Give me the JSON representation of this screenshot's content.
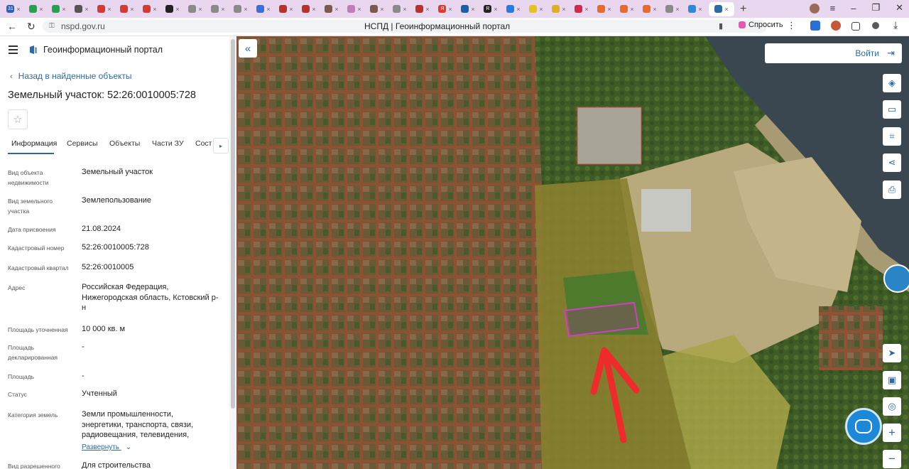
{
  "browser": {
    "tab_favicons": [
      {
        "icon": "calendar-favicon",
        "color": "#2b5fbd",
        "text": "31"
      },
      {
        "icon": "check-favicon",
        "color": "#23a34a",
        "text": ""
      },
      {
        "icon": "check-favicon",
        "color": "#23a34a",
        "text": ""
      },
      {
        "icon": "globe-favicon",
        "color": "#555555",
        "text": ""
      },
      {
        "icon": "record-favicon",
        "color": "#d63a2e",
        "text": ""
      },
      {
        "icon": "record-favicon",
        "color": "#d63a2e",
        "text": ""
      },
      {
        "icon": "record-favicon",
        "color": "#d63a2e",
        "text": ""
      },
      {
        "icon": "dark-favicon",
        "color": "#222222",
        "text": ""
      },
      {
        "icon": "grid-favicon",
        "color": "#8a8a8a",
        "text": ""
      },
      {
        "icon": "grid-favicon",
        "color": "#8a8a8a",
        "text": ""
      },
      {
        "icon": "grid-favicon",
        "color": "#8a8a8a",
        "text": ""
      },
      {
        "icon": "blue-favicon",
        "color": "#3b6fd8",
        "text": ""
      },
      {
        "icon": "emblem-favicon",
        "color": "#b8322a",
        "text": ""
      },
      {
        "icon": "emblem-favicon",
        "color": "#b8322a",
        "text": ""
      },
      {
        "icon": "photo-favicon",
        "color": "#7a5a4a",
        "text": ""
      },
      {
        "icon": "page-favicon",
        "color": "#c77ab8",
        "text": ""
      },
      {
        "icon": "photo-favicon",
        "color": "#7a5a4a",
        "text": ""
      },
      {
        "icon": "grid-favicon",
        "color": "#8a8a8a",
        "text": ""
      },
      {
        "icon": "emblem-favicon",
        "color": "#b8322a",
        "text": ""
      },
      {
        "icon": "yandex-favicon",
        "color": "#e23a2a",
        "text": "Я"
      },
      {
        "icon": "camera-favicon",
        "color": "#1a5fa8",
        "text": ""
      },
      {
        "icon": "r-favicon",
        "color": "#222222",
        "text": "R"
      },
      {
        "icon": "edit-favicon",
        "color": "#2a7be0",
        "text": ""
      },
      {
        "icon": "smile-favicon",
        "color": "#e8c020",
        "text": ""
      },
      {
        "icon": "mail-favicon",
        "color": "#e0b020",
        "text": ""
      },
      {
        "icon": "red-favicon",
        "color": "#d42a4a",
        "text": ""
      },
      {
        "icon": "orange-favicon",
        "color": "#e86a2a",
        "text": ""
      },
      {
        "icon": "orange-favicon",
        "color": "#e86a2a",
        "text": ""
      },
      {
        "icon": "orange-favicon",
        "color": "#e86a2a",
        "text": ""
      },
      {
        "icon": "grid-favicon",
        "color": "#8a8a8a",
        "text": ""
      },
      {
        "icon": "map-favicon",
        "color": "#2a8ad8",
        "text": ""
      },
      {
        "icon": "nspd-favicon",
        "color": "#2d6aa4",
        "text": ""
      }
    ],
    "url": "nspd.gov.ru",
    "page_title": "НСПД | Геоинформационный портал",
    "ask_label": "Спросить"
  },
  "panel": {
    "portal_name": "Геоинформационный портал",
    "back_link": "Назад в найденные объекты",
    "title": "Земельный участок: 52:26:0010005:728",
    "tabs": [
      "Информация",
      "Сервисы",
      "Объекты",
      "Части ЗУ",
      "Сост"
    ],
    "props": [
      {
        "label": "Вид объекта недвижимости",
        "value": "Земельный участок"
      },
      {
        "label": "Вид земельного участка",
        "value": "Землепользование"
      },
      {
        "label": "Дата присвоения",
        "value": "21.08.2024"
      },
      {
        "label": "Кадастровый номер",
        "value": "52:26:0010005:728"
      },
      {
        "label": "Кадастровый квартал",
        "value": "52:26:0010005"
      },
      {
        "label": "Адрес",
        "value": "Российская Федерация, Нижегородская область, Кстовский р-н"
      },
      {
        "label": "Площадь уточненная",
        "value": "10 000 кв. м"
      },
      {
        "label": "Площадь декларированная",
        "value": "-"
      },
      {
        "label": "Площадь",
        "value": "-"
      },
      {
        "label": "Статус",
        "value": "Учтенный"
      },
      {
        "label": "Категория земель",
        "value": "Земли промышленности, энергетики, транспорта, связи, радиовещания, телевидения,"
      },
      {
        "label": "Вид разрешенного",
        "value": "Для строительства"
      }
    ],
    "expand_label": "Развернуть"
  },
  "map": {
    "login_label": "Войти",
    "controls": [
      "layers-icon",
      "ruler-icon",
      "select-area-icon",
      "share-icon",
      "print-icon",
      "locate-icon",
      "minimap-icon",
      "geo-icon",
      "zoom-in-icon",
      "zoom-out-icon"
    ],
    "zoom_in": "+",
    "zoom_out": "−"
  }
}
